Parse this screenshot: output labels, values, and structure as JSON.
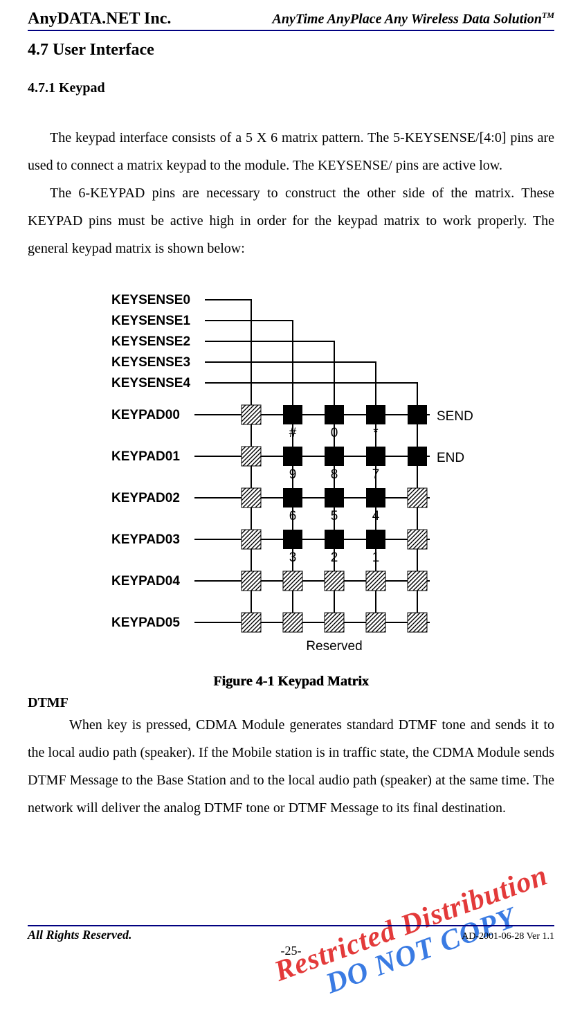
{
  "header": {
    "company": "AnyDATA.NET Inc.",
    "tagline_prefix": "AnyTime AnyPlace Any Wireless Data Solution",
    "tagline_tm": "TM"
  },
  "section": {
    "h1": "4.7 User Interface",
    "h2": "4.7.1 Keypad",
    "p1": "The keypad interface consists of a 5 X 6 matrix pattern. The 5-KEYSENSE/[4:0] pins are used to connect a matrix keypad to the module. The KEYSENSE/ pins are active low.",
    "p2": "The 6-KEYPAD pins are necessary to construct the other side of the matrix. These KEYPAD pins must be active high in order for the keypad matrix to work properly. The general keypad matrix is shown below:"
  },
  "figure": {
    "caption": "Figure 4-1 Keypad Matrix",
    "keysense_labels": [
      "KEYSENSE0",
      "KEYSENSE1",
      "KEYSENSE2",
      "KEYSENSE3",
      "KEYSENSE4"
    ],
    "keypad_labels": [
      "KEYPAD00",
      "KEYPAD01",
      "KEYPAD02",
      "KEYPAD03",
      "KEYPAD04",
      "KEYPAD05"
    ],
    "col_right_labels": [
      "SEND",
      "END"
    ],
    "bottom_label": "Reserved",
    "grid_values": {
      "row0": [
        "",
        "#",
        "0",
        "*",
        ""
      ],
      "row1": [
        "",
        "9",
        "8",
        "7",
        ""
      ],
      "row2": [
        "",
        "6",
        "5",
        "4",
        ""
      ],
      "row3": [
        "",
        "3",
        "2",
        "1",
        ""
      ]
    }
  },
  "dtmf": {
    "heading": "DTMF",
    "body": "When key is pressed, CDMA Module generates standard DTMF tone and sends it to the local audio path (speaker). If the Mobile station is in traffic state, the CDMA Module sends DTMF Message to the Base Station and to the local audio path (speaker) at the same time. The network will deliver the analog DTMF tone or DTMF Message to its final destination."
  },
  "footer": {
    "left": "All Rights Reserved.",
    "right": "AD-2001-06-28 Ver 1.1",
    "page": "-25-"
  },
  "watermark": {
    "line1": "Restricted Distribution",
    "line2": "DO NOT COPY"
  }
}
